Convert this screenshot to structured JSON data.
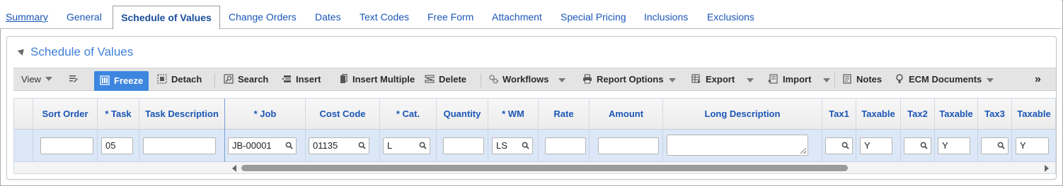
{
  "tabs": [
    {
      "label": "Summary",
      "name": "tab-summary"
    },
    {
      "label": "General",
      "name": "tab-general"
    },
    {
      "label": "Schedule of Values",
      "name": "tab-schedule-of-values"
    },
    {
      "label": "Change Orders",
      "name": "tab-change-orders"
    },
    {
      "label": "Dates",
      "name": "tab-dates"
    },
    {
      "label": "Text Codes",
      "name": "tab-text-codes"
    },
    {
      "label": "Free Form",
      "name": "tab-free-form"
    },
    {
      "label": "Attachment",
      "name": "tab-attachment"
    },
    {
      "label": "Special Pricing",
      "name": "tab-special-pricing"
    },
    {
      "label": "Inclusions",
      "name": "tab-inclusions"
    },
    {
      "label": "Exclusions",
      "name": "tab-exclusions"
    }
  ],
  "active_tab": "Schedule of Values",
  "panel": {
    "title": "Schedule of Values"
  },
  "toolbar": {
    "view": "View",
    "freeze": "Freeze",
    "detach": "Detach",
    "search": "Search",
    "insert": "Insert",
    "insert_multiple": "Insert Multiple",
    "delete": "Delete",
    "workflows": "Workflows",
    "report_options": "Report Options",
    "export": "Export",
    "import": "Import",
    "notes": "Notes",
    "ecm_documents": "ECM Documents",
    "more": "»"
  },
  "columns": [
    "Sort Order",
    "* Task",
    "Task Description",
    "* Job",
    "Cost Code",
    "* Cat.",
    "Quantity",
    "* WM",
    "Rate",
    "Amount",
    "Long Description",
    "Tax1",
    "Taxable",
    "Tax2",
    "Taxable",
    "Tax3",
    "Taxable"
  ],
  "row": {
    "sort_order": "",
    "task": "05",
    "task_description": "",
    "job": "JB-00001",
    "cost_code": "01135",
    "cat": "L",
    "quantity": "",
    "wm": "LS",
    "rate": "",
    "amount": "",
    "long_description": "",
    "tax1": "",
    "taxable1": "Y",
    "tax2": "",
    "taxable2": "Y",
    "tax3": "",
    "taxable3": "Y"
  },
  "colors": {
    "accent": "#3d86e0",
    "link": "#1a56b6",
    "row_selected": "#dce8f7"
  }
}
